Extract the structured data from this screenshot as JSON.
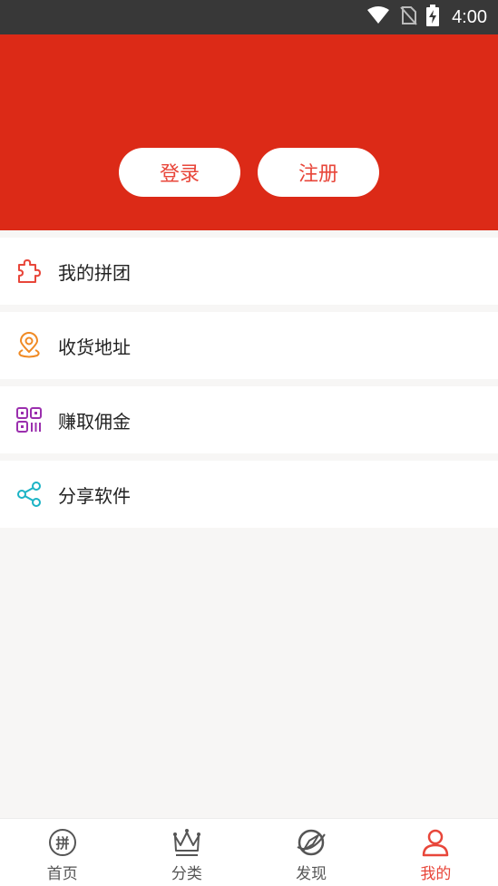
{
  "status_bar": {
    "time": "4:00",
    "icons": [
      "wifi-icon",
      "no-sim-icon",
      "battery-charging-icon"
    ]
  },
  "header": {
    "login_label": "登录",
    "register_label": "注册",
    "background": "#dc2a17"
  },
  "menu": {
    "items": [
      {
        "label": "我的拼团",
        "icon": "puzzle-icon",
        "color": "#e8463a"
      },
      {
        "label": "收货地址",
        "icon": "location-pin-icon",
        "color": "#f08a24"
      },
      {
        "label": "赚取佣金",
        "icon": "qr-code-icon",
        "color": "#9b2fae"
      },
      {
        "label": "分享软件",
        "icon": "share-icon",
        "color": "#1bb3c5"
      }
    ]
  },
  "tabbar": {
    "tabs": [
      {
        "label": "首页",
        "icon": "home-pin-icon"
      },
      {
        "label": "分类",
        "icon": "crown-icon"
      },
      {
        "label": "发现",
        "icon": "compass-icon"
      },
      {
        "label": "我的",
        "icon": "user-icon",
        "active": true
      }
    ],
    "active_color": "#e8463a"
  }
}
